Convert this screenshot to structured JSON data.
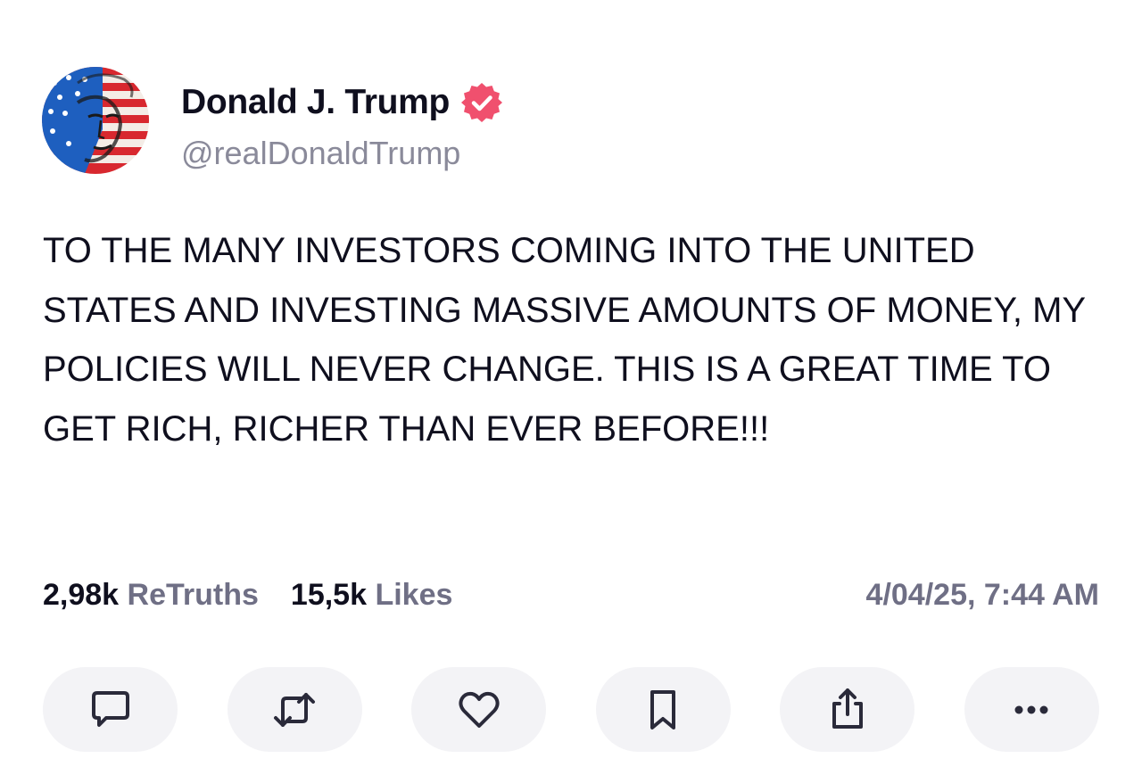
{
  "author": {
    "display_name": "Donald J. Trump",
    "handle": "@realDonaldTrump",
    "verified": true,
    "verified_color": "#f0506e",
    "avatar_icon": "flag-face-avatar"
  },
  "post": {
    "text": "TO THE MANY INVESTORS COMING INTO THE UNITED STATES AND INVESTING MASSIVE AMOUNTS OF MONEY, MY POLICIES WILL NEVER CHANGE. THIS IS A GREAT TIME TO GET RICH, RICHER THAN EVER BEFORE!!!"
  },
  "stats": {
    "retruths_count": "2,98k",
    "retruths_label": "ReTruths",
    "likes_count": "15,5k",
    "likes_label": "Likes",
    "timestamp": "4/04/25, 7:44 AM"
  },
  "actions": [
    {
      "name": "reply",
      "icon": "speech-bubble-icon"
    },
    {
      "name": "retruth",
      "icon": "repost-arrows-icon"
    },
    {
      "name": "like",
      "icon": "heart-icon"
    },
    {
      "name": "bookmark",
      "icon": "bookmark-icon"
    },
    {
      "name": "share",
      "icon": "share-icon"
    },
    {
      "name": "more",
      "icon": "more-dots-icon"
    }
  ],
  "colors": {
    "text_primary": "#0f0f1e",
    "text_secondary": "#6f6f85",
    "button_bg": "#f3f3f6"
  }
}
